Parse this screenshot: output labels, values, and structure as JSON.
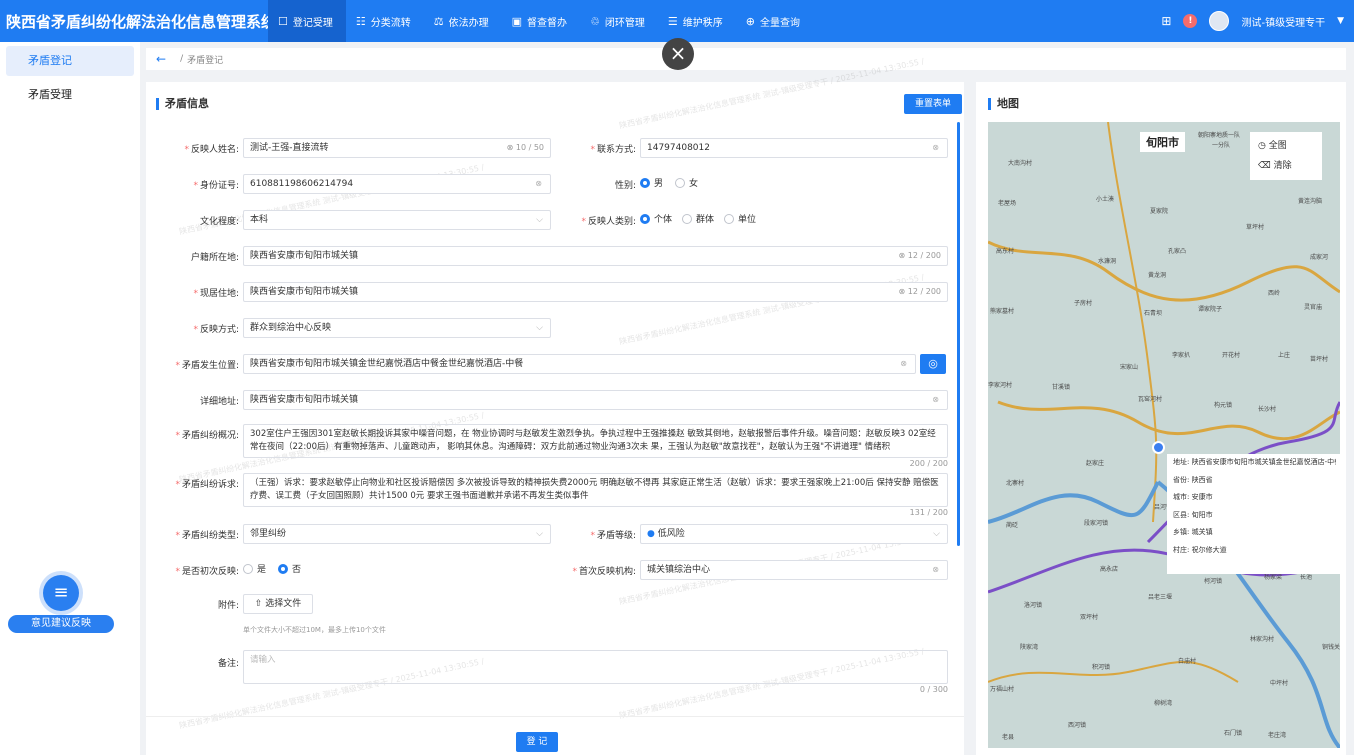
{
  "header": {
    "title": "陕西省矛盾纠纷化解法治化信息管理系统",
    "nav": [
      {
        "icon": "register-icon",
        "glyph": "☐",
        "label": "登记受理",
        "active": true
      },
      {
        "icon": "classify-icon",
        "glyph": "☷",
        "label": "分类流转",
        "active": false
      },
      {
        "icon": "law-icon",
        "glyph": "⚖",
        "label": "依法办理",
        "active": false
      },
      {
        "icon": "supervise-icon",
        "glyph": "▣",
        "label": "督查督办",
        "active": false
      },
      {
        "icon": "loop-icon",
        "glyph": "♲",
        "label": "闭环管理",
        "active": false
      },
      {
        "icon": "order-icon",
        "glyph": "☰",
        "label": "维护秩序",
        "active": false
      },
      {
        "icon": "query-icon",
        "glyph": "⊕",
        "label": "全量查询",
        "active": false
      }
    ],
    "alert_count": "!",
    "user": "测试-镇级受理专干"
  },
  "sidebar": {
    "items": [
      {
        "label": "矛盾登记",
        "active": true
      },
      {
        "label": "矛盾受理",
        "active": false
      }
    ],
    "feedback_label": "意见建议反映"
  },
  "breadcrumb": {
    "current": "矛盾登记"
  },
  "form": {
    "section_title": "矛盾信息",
    "reset_label": "重置表单",
    "name": {
      "label": "反映人姓名:",
      "value": "测试-王强-直接流转",
      "count": "10 / 50"
    },
    "phone": {
      "label": "联系方式:",
      "value": "14797408012"
    },
    "idcard": {
      "label": "身份证号:",
      "value": "610881198606214794"
    },
    "gender": {
      "label": "性别:",
      "options": [
        "男",
        "女"
      ],
      "selected": "男"
    },
    "education": {
      "label": "文化程度:",
      "value": "本科"
    },
    "reporter_type": {
      "label": "反映人类别:",
      "options": [
        "个体",
        "群体",
        "单位"
      ],
      "selected": "个体"
    },
    "household": {
      "label": "户籍所在地:",
      "value": "陕西省安康市旬阳市城关镇",
      "count": "12 / 200"
    },
    "residence": {
      "label": "现居住地:",
      "value": "陕西省安康市旬阳市城关镇",
      "count": "12 / 200"
    },
    "report_method": {
      "label": "反映方式:",
      "value": "群众到综治中心反映"
    },
    "location": {
      "label": "矛盾发生位置:",
      "value": "陕西省安康市旬阳市城关镇金世纪嘉悦酒店中餐金世纪嘉悦酒店-中餐"
    },
    "address": {
      "label": "详细地址:",
      "value": "陕西省安康市旬阳市城关镇"
    },
    "overview": {
      "label": "矛盾纠纷概况:",
      "value": "302室住户王强因301室赵敏长期投诉其家中噪音问题，在 物业协调时与赵敏发生激烈争执。争执过程中王强推搡赵 敏致其倒地，赵敏报警后事件升级。噪音问题：赵敏反映3 02室经常在夜间（22:00后）有重物掉落声、儿童跑动声， 影响其休息。沟通障碍：双方此前通过物业沟通3次未 果，王强认为赵敏\"故意找茬\"，赵敏认为王强\"不讲道理\" 情绪积",
      "count": "200 / 200"
    },
    "demand": {
      "label": "矛盾纠纷诉求:",
      "value": "（王强）诉求：要求赵敏停止向物业和社区投诉赔偿因 多次被投诉导致的精神损失费2000元 明确赵敏不得再 其家庭正常生活（赵敏）诉求：要求王强家晚上21:00后 保持安静 赔偿医疗费、误工费（子女回国照顾）共计1500 0元 要求王强书面道歉并承诺不再发生类似事件",
      "count": "131 / 200"
    },
    "dispute_type": {
      "label": "矛盾纠纷类型:",
      "value": "邻里纠纷"
    },
    "risk_level": {
      "label": "矛盾等级:",
      "value": "低风险"
    },
    "first_report": {
      "label": "是否初次反映:",
      "options": [
        "是",
        "否"
      ],
      "selected": "否"
    },
    "first_agency": {
      "label": "首次反映机构:",
      "value": "城关镇综治中心"
    },
    "attachment": {
      "label": "附件:",
      "button": "选择文件",
      "hint": "单个文件大小不超过10M，最多上传10个文件"
    },
    "remark": {
      "label": "备注:",
      "placeholder": "请输入",
      "count": "0 / 300"
    },
    "submit_label": "登 记"
  },
  "map": {
    "title": "地图",
    "city": "旬阳市",
    "controls": [
      "全图",
      "清除"
    ],
    "place_labels": [
      "朝阳寨地质一队",
      "一分队",
      "大南沟村",
      "小土湊",
      "夏家院",
      "黄连沟脑",
      "老屋场",
      "草坪村",
      "高东村",
      "孔家凸",
      "水濂洞",
      "成家河",
      "黄龙洞",
      "子房村",
      "西岭",
      "灵官庙",
      "熊家墓村",
      "石青坝",
      "谭家院子",
      "李家扒",
      "开花村",
      "上庄",
      "苗坪村",
      "李家河村",
      "宋家山",
      "甘溪镇",
      "瓦窑河村",
      "构元镇",
      "长沙村",
      "赵家庄",
      "北寨村",
      "蔺砭",
      "段家河镇",
      "吕河镇",
      "高永店",
      "柯河镇",
      "杨家梁",
      "长池",
      "洛河镇",
      "吕老三堰",
      "双坪村",
      "陕家湾",
      "林家沟村",
      "铜钱关",
      "白庙村",
      "积河镇",
      "万福山村",
      "中坪村",
      "柳树湾",
      "老县",
      "西河镇",
      "石门镇",
      "老庄湾"
    ],
    "info": [
      "地址: 陕西省安康市旬阳市城关镇金世纪嘉悦酒店-中餐",
      "省份: 陕西省",
      "城市: 安康市",
      "区县: 旬阳市",
      "乡镇: 城关镇",
      "村庄: 祝尔修大道"
    ]
  },
  "watermark": "陕西省矛盾纠纷化解法治化信息管理系统 测试-镇级受理专干 / 2025-11-04 13:30:55 /"
}
